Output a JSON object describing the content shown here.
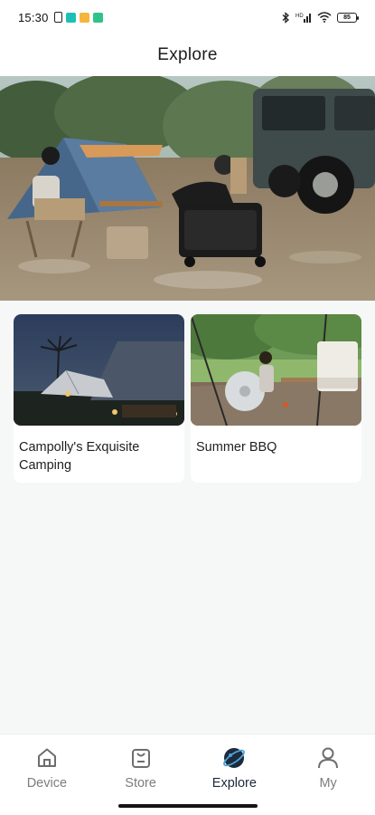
{
  "status_bar": {
    "time": "15:30",
    "battery": "85"
  },
  "header": {
    "title": "Explore"
  },
  "hero": {
    "image": "camping-scene-with-tent-and-jeep"
  },
  "cards": [
    {
      "title": "Campolly's Exquisite Camping",
      "image": "night-tent-camping"
    },
    {
      "title": "Summer BBQ",
      "image": "summer-bbq-outdoor"
    }
  ],
  "tabbar": {
    "tabs": [
      {
        "label": "Device",
        "icon": "home-icon",
        "active": false
      },
      {
        "label": "Store",
        "icon": "bag-icon",
        "active": false
      },
      {
        "label": "Explore",
        "icon": "planet-icon",
        "active": true
      },
      {
        "label": "My",
        "icon": "person-icon",
        "active": false
      }
    ]
  },
  "colors": {
    "accent": "#1c2a3c",
    "inactive": "#7d7d7d",
    "background": "#f6f7f7"
  }
}
